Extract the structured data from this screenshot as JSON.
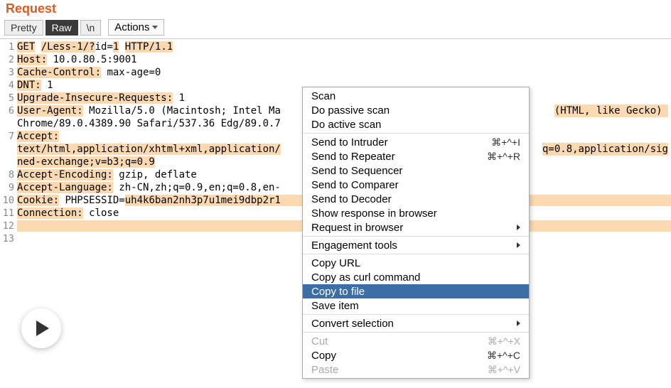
{
  "header": {
    "title": "Request"
  },
  "toolbar": {
    "pretty": "Pretty",
    "raw": "Raw",
    "newline": "\\n",
    "actions": "Actions"
  },
  "request": {
    "lines": [
      {
        "n": 1,
        "segments": [
          {
            "t": "GET",
            "h": true
          },
          {
            "t": " ",
            "h": false
          },
          {
            "t": "/Less-1/?",
            "h": true
          },
          {
            "t": "id",
            "h": false
          },
          {
            "t": "=",
            "h": false
          },
          {
            "t": "1",
            "h": true
          },
          {
            "t": " ",
            "h": false
          },
          {
            "t": "HTTP/1.1",
            "h": true
          }
        ]
      },
      {
        "n": 2,
        "segments": [
          {
            "t": "Host:",
            "h": true
          },
          {
            "t": " 10.0.80.5:9001",
            "h": false
          }
        ]
      },
      {
        "n": 3,
        "segments": [
          {
            "t": "Cache-Control:",
            "h": true
          },
          {
            "t": " max-age=0",
            "h": false
          }
        ]
      },
      {
        "n": 4,
        "segments": [
          {
            "t": "DNT:",
            "h": true
          },
          {
            "t": " 1",
            "h": false
          }
        ]
      },
      {
        "n": 5,
        "segments": [
          {
            "t": "Upgrade-Insecure-Requests:",
            "h": true
          },
          {
            "t": " 1",
            "h": false
          }
        ]
      },
      {
        "n": 6,
        "segments": [
          {
            "t": "User-Agent:",
            "h": true
          },
          {
            "t": " Mozilla/5.0 (Macintosh; Intel Ma",
            "h": false
          }
        ],
        "trail": {
          "t": "(HTML, like Gecko) ",
          "h": true
        }
      },
      {
        "n": "",
        "segments": [
          {
            "t": "Chrome/89.0.4389.90 Safari/537.36 Edg/89.0.7",
            "h": false
          }
        ]
      },
      {
        "n": 7,
        "segments": [
          {
            "t": "Accept:",
            "h": true
          }
        ]
      },
      {
        "n": "",
        "segments": [
          {
            "t": "text/html,application/xhtml+xml,application/",
            "h": true
          }
        ],
        "trail": {
          "t": "q=0.8,application/sig",
          "h": true
        }
      },
      {
        "n": "",
        "segments": [
          {
            "t": "ned-exchange;v=b3;q=0.9",
            "h": true
          }
        ]
      },
      {
        "n": 8,
        "segments": [
          {
            "t": "Accept-Encoding:",
            "h": true
          },
          {
            "t": " gzip, deflate",
            "h": false
          }
        ]
      },
      {
        "n": 9,
        "segments": [
          {
            "t": "Accept-Language:",
            "h": true
          },
          {
            "t": " zh-CN,zh;q=0.9,en;q=0.8,en-",
            "h": false
          }
        ]
      },
      {
        "n": 10,
        "segments": [
          {
            "t": "Cookie:",
            "h": true
          },
          {
            "t": " PHPSESSID=",
            "h": false
          },
          {
            "t": "uh4k6ban2nh3p7u1mei9dbp2r1",
            "h": true
          }
        ],
        "fullTrail": true
      },
      {
        "n": 11,
        "segments": [
          {
            "t": "Connection:",
            "h": true
          },
          {
            "t": " close",
            "h": false
          }
        ]
      },
      {
        "n": 12,
        "segments": [],
        "fullTrail": true
      },
      {
        "n": 13,
        "segments": []
      }
    ]
  },
  "menu": {
    "items": [
      {
        "label": "Scan",
        "type": "item"
      },
      {
        "label": "Do passive scan",
        "type": "item"
      },
      {
        "label": "Do active scan",
        "type": "item"
      },
      {
        "type": "sep"
      },
      {
        "label": "Send to Intruder",
        "shortcut": "⌘+^+I",
        "type": "item"
      },
      {
        "label": "Send to Repeater",
        "shortcut": "⌘+^+R",
        "type": "item"
      },
      {
        "label": "Send to Sequencer",
        "type": "item"
      },
      {
        "label": "Send to Comparer",
        "type": "item"
      },
      {
        "label": "Send to Decoder",
        "type": "item"
      },
      {
        "label": "Show response in browser",
        "type": "item"
      },
      {
        "label": "Request in browser",
        "type": "submenu"
      },
      {
        "type": "sep"
      },
      {
        "label": "Engagement tools",
        "type": "submenu"
      },
      {
        "type": "sep"
      },
      {
        "label": "Copy URL",
        "type": "item"
      },
      {
        "label": "Copy as curl command",
        "type": "item"
      },
      {
        "label": "Copy to file",
        "type": "item",
        "highlight": true
      },
      {
        "label": "Save item",
        "type": "item"
      },
      {
        "type": "sep"
      },
      {
        "label": "Convert selection",
        "type": "submenu"
      },
      {
        "type": "sep"
      },
      {
        "label": "Cut",
        "shortcut": "⌘+^+X",
        "type": "item",
        "disabled": true
      },
      {
        "label": "Copy",
        "shortcut": "⌘+^+C",
        "type": "item"
      },
      {
        "label": "Paste",
        "shortcut": "⌘+^+V",
        "type": "item",
        "disabled": true
      }
    ]
  }
}
